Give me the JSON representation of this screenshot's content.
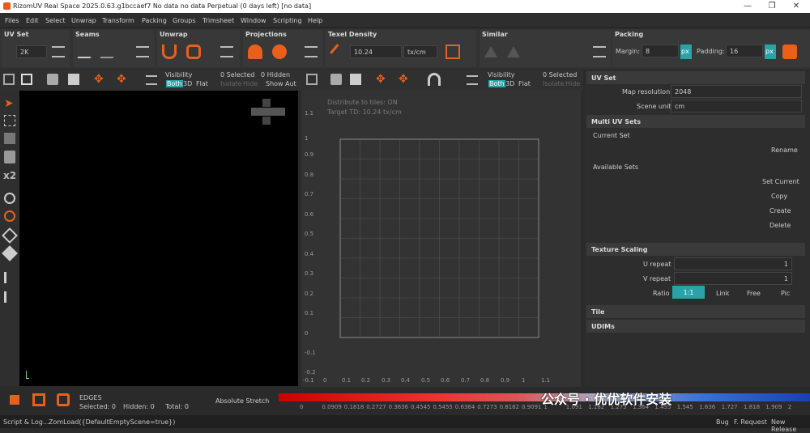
{
  "titlebar": {
    "title": "RizomUV  Real Space 2025.0.63.g1bccaef7 No data no data Perpetual  (0 days left) [no data]",
    "minimize": "—",
    "maximize": "❐",
    "close": "✕"
  },
  "menu": [
    "Files",
    "Edit",
    "Select",
    "Unwrap",
    "Transform",
    "Packing",
    "Groups",
    "Trimsheet",
    "Window",
    "Scripting",
    "Help"
  ],
  "toolbar": {
    "uvset_label": "UV Set",
    "uvset_res": "2K",
    "seams_label": "Seams",
    "unwrap_label": "Unwrap",
    "projections_label": "Projections",
    "texel_label": "Texel Density",
    "texel_value": "10.24",
    "texel_unit": "tx/cm",
    "similar_label": "Similar",
    "packing_label": "Packing",
    "margin_label": "Margin:",
    "margin_value": "8",
    "margin_unit": "px",
    "padding_label": "Padding:",
    "padding_value": "16",
    "padding_unit": "px"
  },
  "viewport3d": {
    "visibility": "Visibility",
    "both": "Both",
    "three_d": "3D",
    "flat": "Flat",
    "selected": "0 Selected",
    "hidden": "0 Hidden",
    "isolate": "Isolate",
    "hide": "Hide",
    "show": "Show",
    "auto": "Aut"
  },
  "viewportuv": {
    "visibility": "Visibility",
    "both": "Both",
    "three_d": "3D",
    "flat": "Flat",
    "selected": "0 Selected",
    "isolate": "Isolate",
    "hide": "Hide",
    "info1": "Distribute to tiles: ON",
    "info2": "Target TD: 10.24 tx/cm",
    "yticks": [
      "1.1",
      "1",
      "0.9",
      "0.8",
      "0.7",
      "0.6",
      "0.5",
      "0.4",
      "0.3",
      "0.2",
      "0.1",
      "0",
      "-0.1",
      "-0.2"
    ],
    "xticks": [
      "-0.1",
      "0",
      "0.1",
      "0.2",
      "0.3",
      "0.4",
      "0.5",
      "0.6",
      "0.7",
      "0.8",
      "0.9",
      "1",
      "1.1"
    ]
  },
  "rightpanel": {
    "uvset_title": "UV Set",
    "map_res_label": "Map resolution",
    "map_res_value": "2048",
    "scene_unit_label": "Scene unit",
    "scene_unit_value": "cm",
    "multi_title": "Multi UV Sets",
    "current_set": "Current Set",
    "rename": "Rename",
    "available_sets": "Available Sets",
    "set_current": "Set Current",
    "copy": "Copy",
    "create": "Create",
    "delete": "Delete",
    "texscale_title": "Texture Scaling",
    "urepeat_label": "U repeat",
    "urepeat_value": "1",
    "vrepeat_label": "V repeat",
    "vrepeat_value": "1",
    "ratio_label": "Ratio",
    "ratio_opts": [
      "1:1",
      "Link",
      "Free",
      "Pic"
    ],
    "tile_title": "Tile",
    "udims_title": "UDIMs",
    "help": "?"
  },
  "bottom": {
    "mode": "EDGES",
    "selected": "Selected: 0",
    "hidden": "Hidden: 0",
    "total": "Total: 0",
    "stretch": "Absolute Stretch",
    "scale": [
      "0",
      "0.0909",
      "0.1818",
      "0.2727",
      "0.3636",
      "0.4545",
      "0.5455",
      "0.6364",
      "0.7273",
      "0.8182",
      "0.9091",
      "1",
      "1.091",
      "1.182",
      "1.273",
      "1.364",
      "1.455",
      "1.545",
      "1.636",
      "1.727",
      "1.818",
      "1.909",
      "2"
    ],
    "watermark": "公众号 · 优优软件安装"
  },
  "status": {
    "left": "Script & Log...",
    "cmd": "ZomLoad({DefaultEmptyScene=true})",
    "bug": "Bug",
    "freq": "F. Request",
    "newrel": "New Release"
  },
  "colors": {
    "accent": "#2aa3a8",
    "orange": "#e8601c"
  }
}
